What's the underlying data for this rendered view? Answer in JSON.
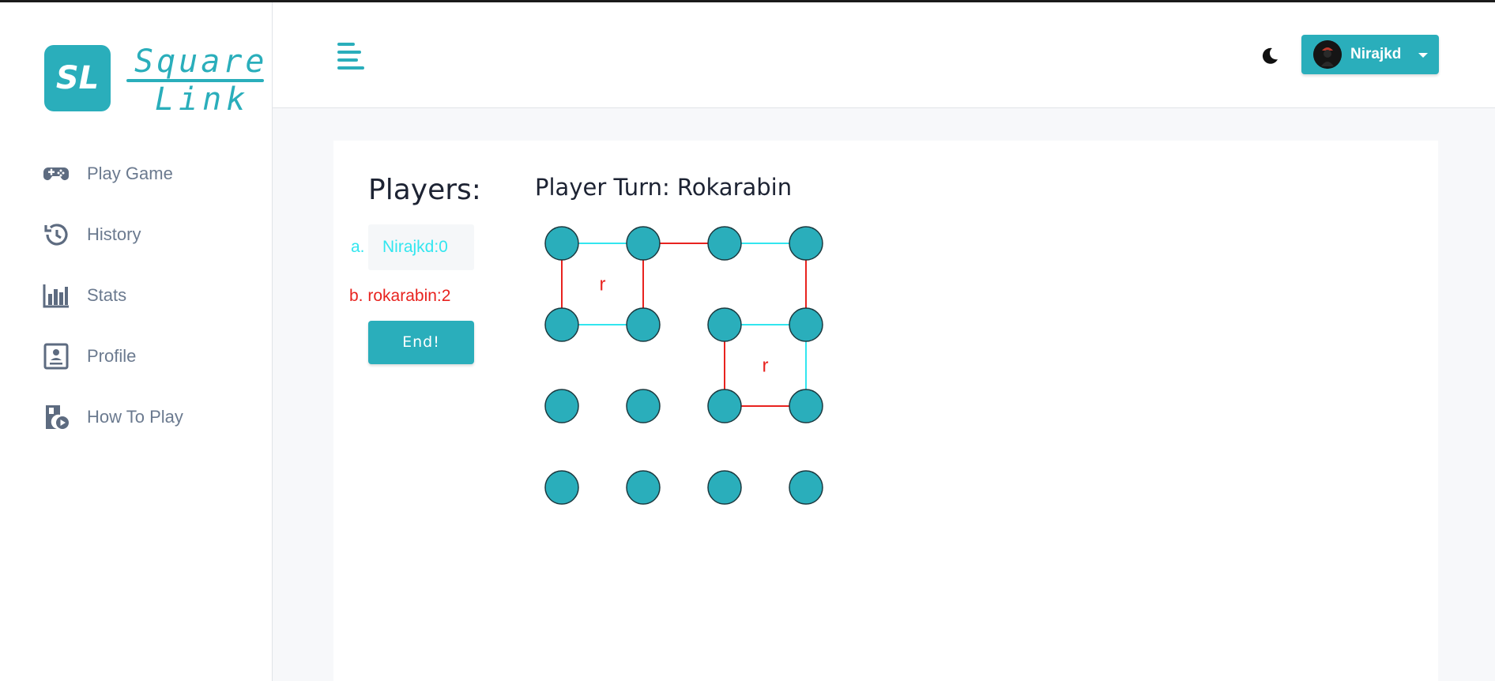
{
  "app": {
    "logo_initials": "SL",
    "logo_line1": "Square",
    "logo_line2": "Link"
  },
  "sidebar": {
    "items": [
      {
        "label": "Play Game",
        "icon": "gamepad-icon"
      },
      {
        "label": "History",
        "icon": "history-icon"
      },
      {
        "label": "Stats",
        "icon": "bar-chart-icon"
      },
      {
        "label": "Profile",
        "icon": "profile-card-icon"
      },
      {
        "label": "How To Play",
        "icon": "video-guide-icon"
      }
    ]
  },
  "header": {
    "user_name": "Nirajkd",
    "theme_icon": "moon-icon",
    "menu_icon": "hamburger-icon"
  },
  "game": {
    "players_title": "Players:",
    "players": [
      {
        "marker": "a.",
        "label": "Nirajkd:0",
        "color": "#32e6ef"
      },
      {
        "marker": "b.",
        "label": "rokarabin:2",
        "color": "#e8231f"
      }
    ],
    "end_button": "End!",
    "turn_label": "Player Turn: Rokarabin",
    "board": {
      "rows": 4,
      "cols": 4,
      "dot_color": "#2aaebb",
      "lines": [
        {
          "from": [
            0,
            0
          ],
          "to": [
            0,
            1
          ],
          "color": "#32e6ef"
        },
        {
          "from": [
            0,
            1
          ],
          "to": [
            0,
            2
          ],
          "color": "#e8231f"
        },
        {
          "from": [
            0,
            2
          ],
          "to": [
            0,
            3
          ],
          "color": "#32e6ef"
        },
        {
          "from": [
            0,
            0
          ],
          "to": [
            1,
            0
          ],
          "color": "#e8231f"
        },
        {
          "from": [
            0,
            1
          ],
          "to": [
            1,
            1
          ],
          "color": "#e8231f"
        },
        {
          "from": [
            0,
            3
          ],
          "to": [
            1,
            3
          ],
          "color": "#e8231f"
        },
        {
          "from": [
            1,
            0
          ],
          "to": [
            1,
            1
          ],
          "color": "#32e6ef"
        },
        {
          "from": [
            1,
            2
          ],
          "to": [
            1,
            3
          ],
          "color": "#32e6ef"
        },
        {
          "from": [
            1,
            2
          ],
          "to": [
            2,
            2
          ],
          "color": "#e8231f"
        },
        {
          "from": [
            1,
            3
          ],
          "to": [
            2,
            3
          ],
          "color": "#32e6ef"
        },
        {
          "from": [
            2,
            2
          ],
          "to": [
            2,
            3
          ],
          "color": "#e8231f"
        }
      ],
      "boxes": [
        {
          "row": 0,
          "col": 0,
          "owner_mark": "r",
          "color": "#e8231f"
        },
        {
          "row": 1,
          "col": 2,
          "owner_mark": "r",
          "color": "#e8231f"
        }
      ]
    }
  }
}
